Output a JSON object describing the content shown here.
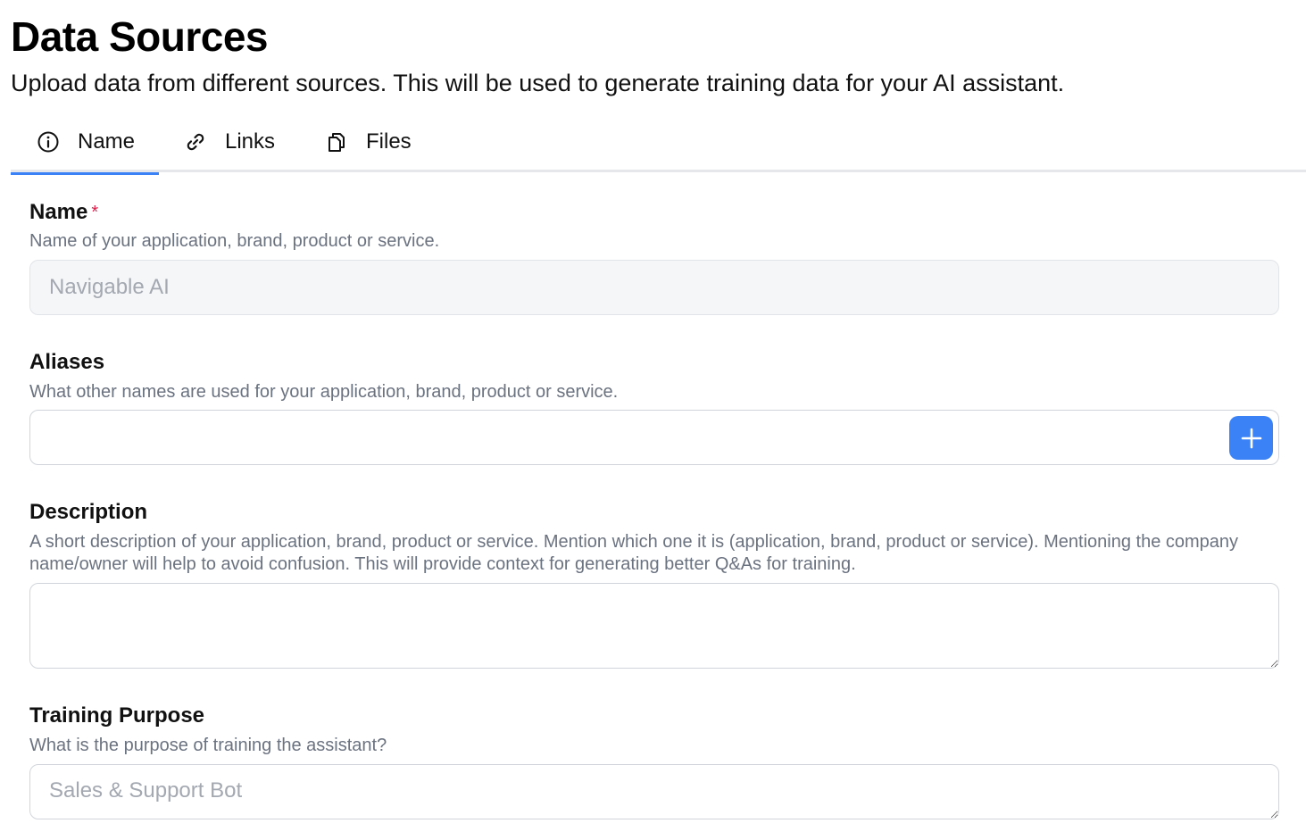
{
  "header": {
    "title": "Data Sources",
    "subtitle": "Upload data from different sources. This will be used to generate training data for your AI assistant."
  },
  "tabs": [
    {
      "label": "Name",
      "icon": "info-circle-icon",
      "active": true
    },
    {
      "label": "Links",
      "icon": "link-icon",
      "active": false
    },
    {
      "label": "Files",
      "icon": "files-icon",
      "active": false
    }
  ],
  "form": {
    "name": {
      "label": "Name",
      "required_mark": "*",
      "help": "Name of your application, brand, product or service.",
      "placeholder": "Navigable AI",
      "value": ""
    },
    "aliases": {
      "label": "Aliases",
      "help": "What other names are used for your application, brand, product or service.",
      "value": "",
      "add_icon": "plus-icon"
    },
    "description": {
      "label": "Description",
      "help": "A short description of your application, brand, product or service. Mention which one it is (application, brand, product or service). Mentioning the company name/owner will help to avoid confusion. This will provide context for generating better Q&As for training.",
      "value": ""
    },
    "training_purpose": {
      "label": "Training Purpose",
      "help": "What is the purpose of training the assistant?",
      "placeholder": "Sales & Support Bot",
      "value": ""
    }
  },
  "colors": {
    "accent": "#3b82f6",
    "required": "#e11d48",
    "help_text": "#6b7280",
    "border": "#d1d5db"
  }
}
